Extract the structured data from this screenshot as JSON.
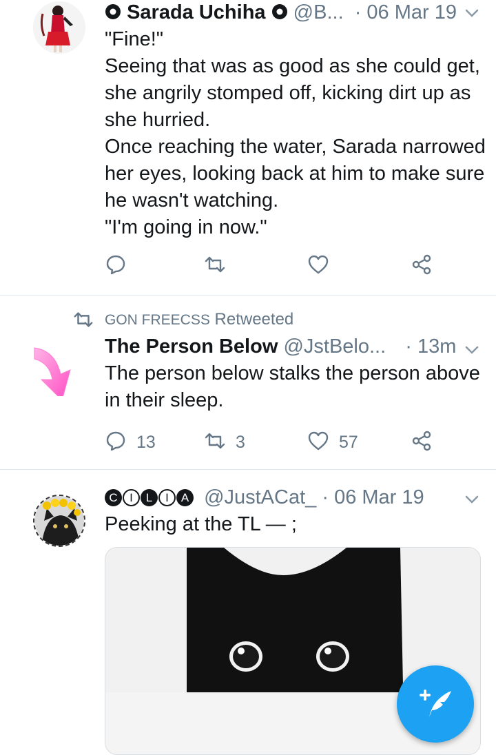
{
  "colors": {
    "accent": "#1da1f2",
    "muted": "#657786",
    "separator": "#e1e8ed"
  },
  "tweets": [
    {
      "name": "Sarada Uchiha",
      "handle": "@B...",
      "time": "· 06 Mar 19",
      "text": "\"Fine!\"\nSeeing that was as good as she could get, she angrily stomped off, kicking dirt up as she hurried.\nOnce reaching the water, Sarada narrowed her eyes, looking back at him to make sure he wasn't watching.\n\"I'm going in now.\""
    },
    {
      "retweeted_by": "GON FREECSS",
      "retweeted_label": "Retweeted",
      "name": "The Person Below",
      "handle": "@JstBelo...",
      "time": "· 13m",
      "text": "The person below stalks the person above in their sleep.",
      "replies": "13",
      "retweets": "3",
      "likes": "57"
    },
    {
      "name_badges": [
        "C",
        "I",
        "L",
        "I",
        "A"
      ],
      "handle": "@JustACat_",
      "time": "· 06 Mar 19",
      "text": "Peeking at the TL — ;"
    }
  ]
}
